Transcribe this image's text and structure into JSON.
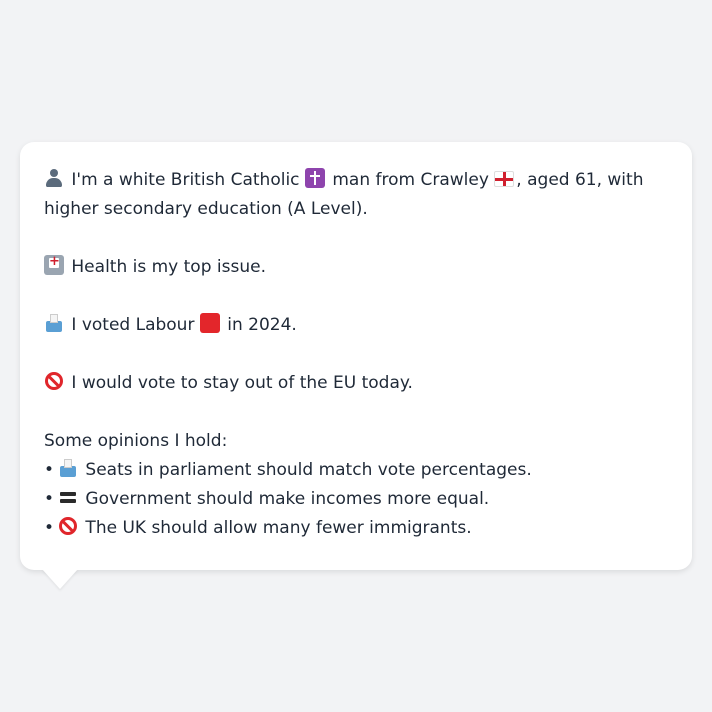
{
  "profile": {
    "intro_part1": " I'm a white British Catholic ",
    "intro_part2": " man from Crawley ",
    "intro_part3": ", aged 61, with higher secondary education (A Level).",
    "top_issue": " Health is my top issue.",
    "vote_part1": " I voted Labour ",
    "vote_part2": " in 2024.",
    "eu_stance": " I would vote to stay out of the EU today."
  },
  "opinions": {
    "heading": "Some opinions I hold:",
    "bullet": "•",
    "items": [
      {
        "icon": "ballot-box-icon",
        "text": " Seats in parliament should match vote percentages."
      },
      {
        "icon": "equals-icon",
        "text": " Government should make incomes more equal."
      },
      {
        "icon": "prohibited-icon",
        "text": " The UK should allow many fewer immigrants."
      }
    ]
  },
  "icons": {
    "person": "person-silhouette-icon",
    "cross": "latin-cross-icon",
    "flag": "flag-england-icon",
    "hospital": "hospital-icon",
    "ballot": "ballot-box-icon",
    "labour_color": "red-square-icon",
    "eu": "prohibited-icon"
  },
  "colors": {
    "background": "#f2f3f5",
    "card": "#ffffff",
    "text": "#1f2937",
    "labour_red": "#e3262b"
  }
}
